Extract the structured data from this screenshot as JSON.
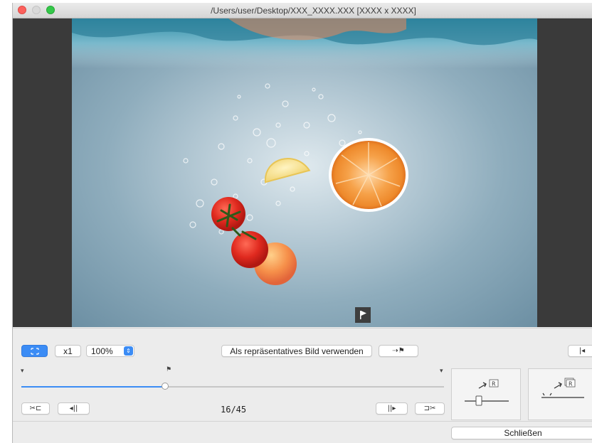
{
  "window": {
    "title": "/Users/user/Desktop/XXX_XXXX.XXX [XXXX x XXXX]"
  },
  "toolbar": {
    "fit_icon": "fit-screen-icon",
    "zoom_x1_label": "x1",
    "zoom_value": "100%",
    "representative_label": "Als repräsentatives Bild verwenden",
    "set_flag_icon": "set-flag-icon",
    "go_first_icon": "go-first-icon"
  },
  "playback": {
    "counter": "16/45",
    "current_frame": 16,
    "total_frames": 45,
    "buttons": [
      "cut-start-icon",
      "step-back-icon",
      "step-forward-icon",
      "cut-end-icon"
    ]
  },
  "panels": {
    "save_single_icon": "save-single-frame-icon",
    "save_range_icon": "save-frame-range-icon",
    "panel_letter": "R"
  },
  "footer": {
    "close_label": "Schließen"
  },
  "colors": {
    "accent": "#3b8cf5",
    "viewer_bg": "#3a3a3a",
    "window_bg": "#ececec"
  }
}
